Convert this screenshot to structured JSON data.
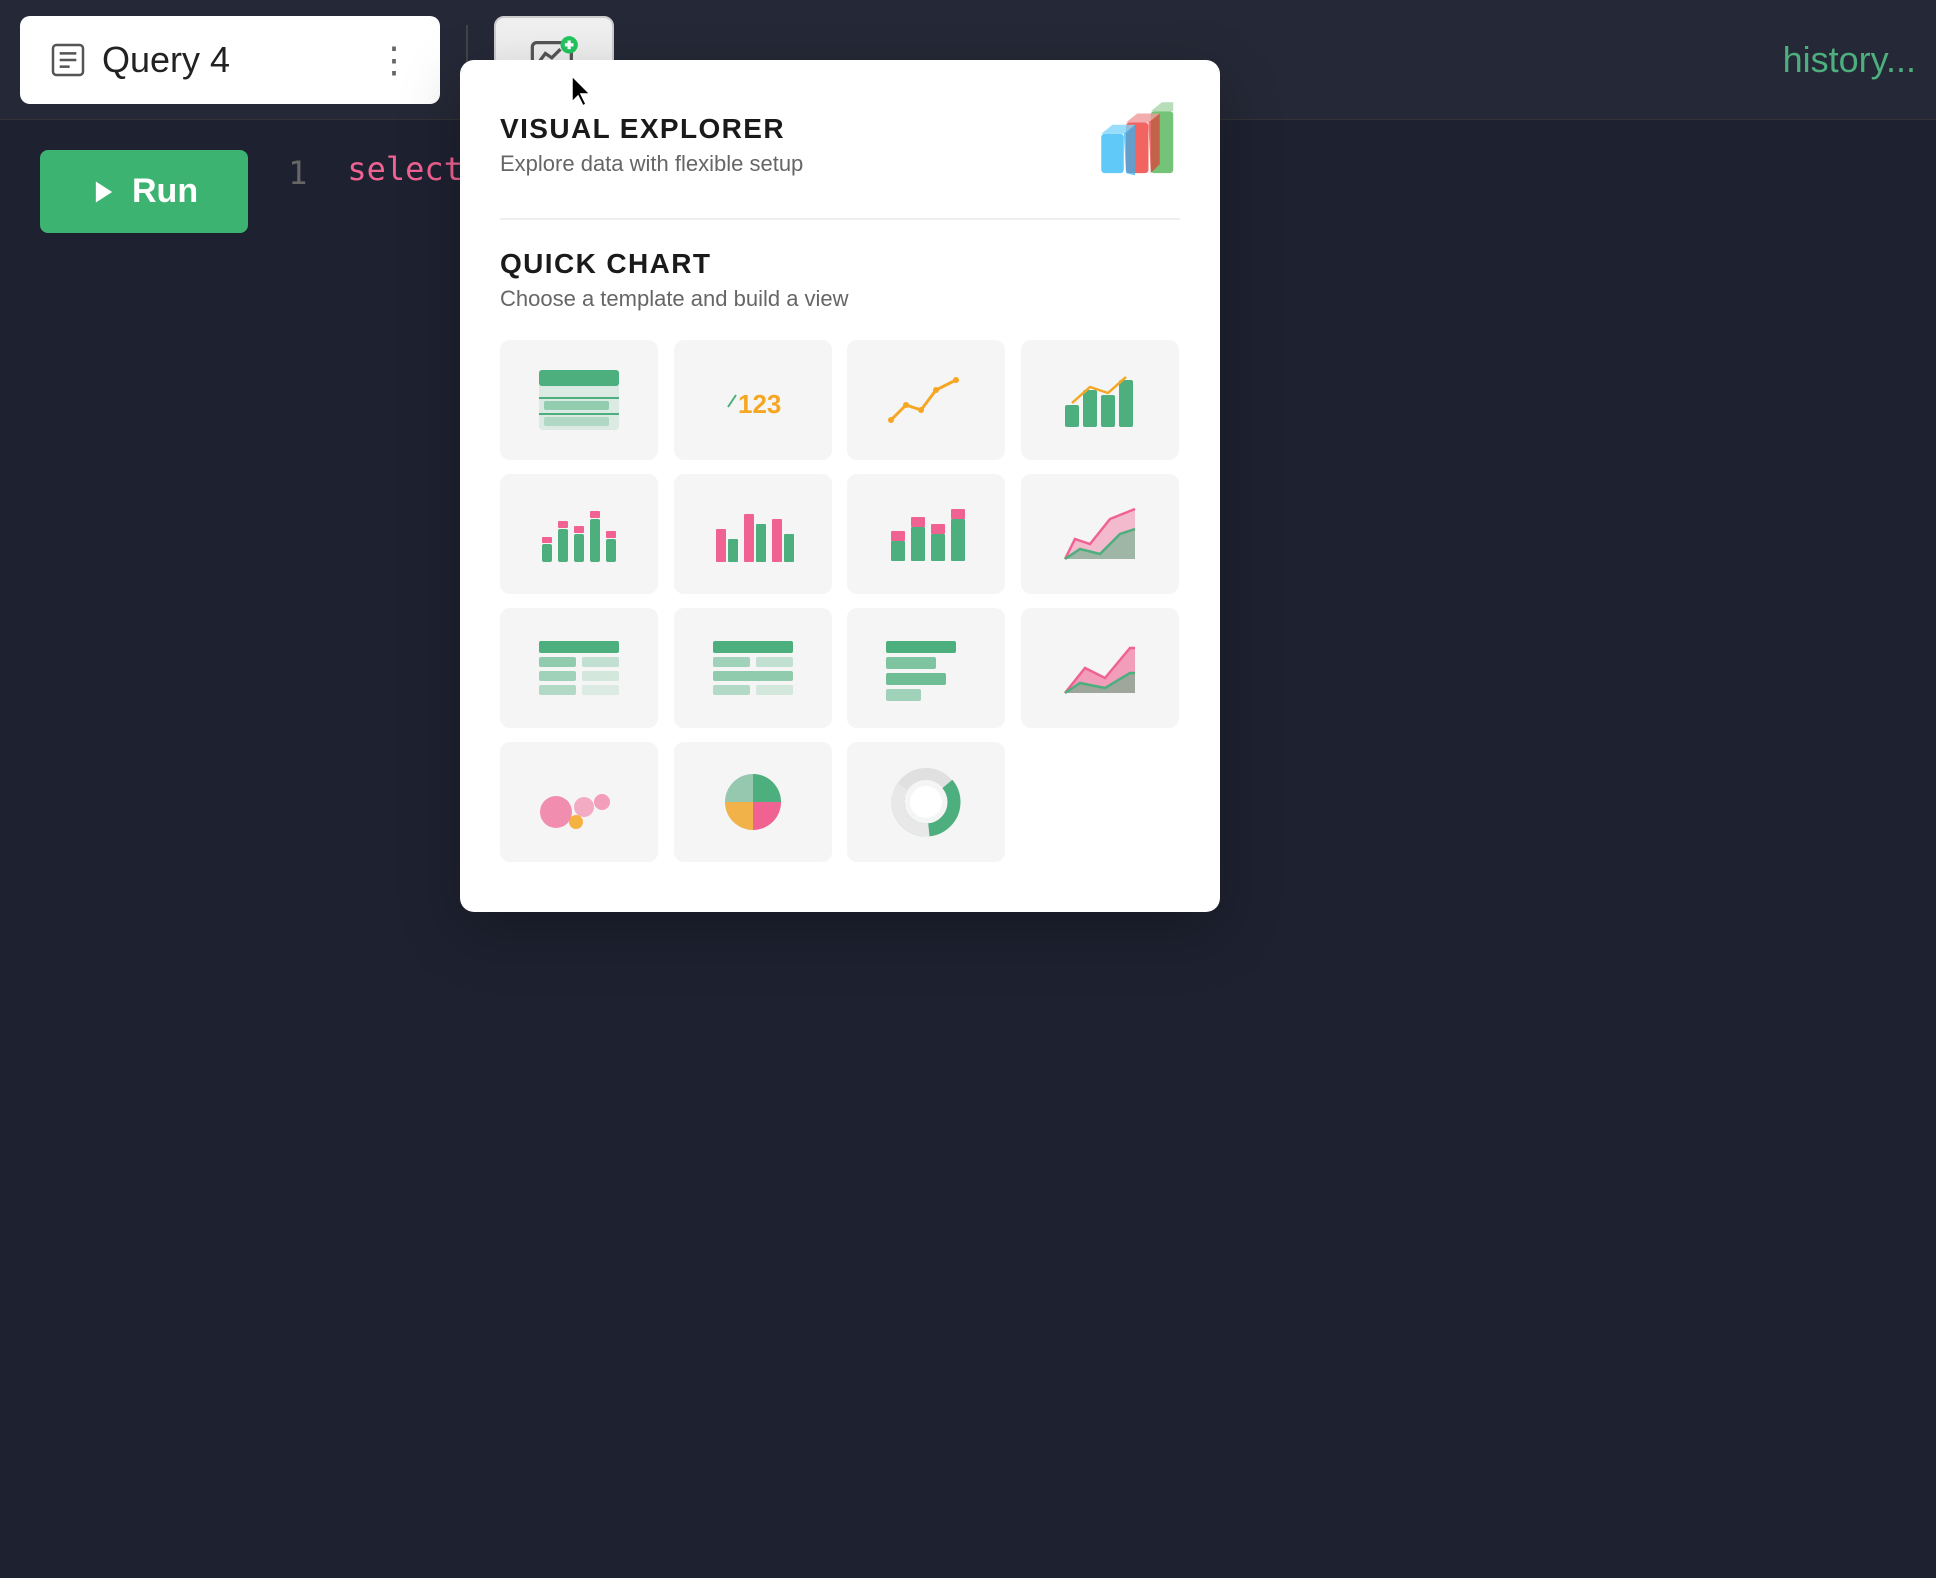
{
  "topbar": {
    "tab": {
      "title": "Query 4",
      "icon": "query-icon",
      "menu_label": "⋮"
    },
    "history_label": "history...",
    "add_viz_label": "add-visualization"
  },
  "editor": {
    "run_label": "Run",
    "line_number": "1",
    "code": "select * from b"
  },
  "dropdown": {
    "visual_explorer": {
      "title": "VISUAL EXPLORER",
      "subtitle": "Explore data with flexible setup"
    },
    "quick_chart": {
      "title": "QUICK CHART",
      "subtitle": "Choose a template and build a view"
    },
    "chart_types": [
      {
        "name": "table",
        "label": "Table"
      },
      {
        "name": "metric",
        "label": "Metric"
      },
      {
        "name": "line-chart",
        "label": "Line Chart"
      },
      {
        "name": "bar-line-chart",
        "label": "Bar+Line Chart"
      },
      {
        "name": "scatter-bar",
        "label": "Scatter Bar"
      },
      {
        "name": "grouped-bar",
        "label": "Grouped Bar"
      },
      {
        "name": "stacked-bar",
        "label": "Stacked Bar"
      },
      {
        "name": "area-chart",
        "label": "Area Chart"
      },
      {
        "name": "pivot-table",
        "label": "Pivot Table"
      },
      {
        "name": "pivot-table-2",
        "label": "Pivot Table 2"
      },
      {
        "name": "horizontal-bar",
        "label": "Horizontal Bar"
      },
      {
        "name": "area-chart-2",
        "label": "Area Chart 2"
      },
      {
        "name": "bubble-chart",
        "label": "Bubble Chart"
      },
      {
        "name": "pie-chart",
        "label": "Pie Chart"
      },
      {
        "name": "donut-chart",
        "label": "Donut Chart"
      }
    ]
  }
}
